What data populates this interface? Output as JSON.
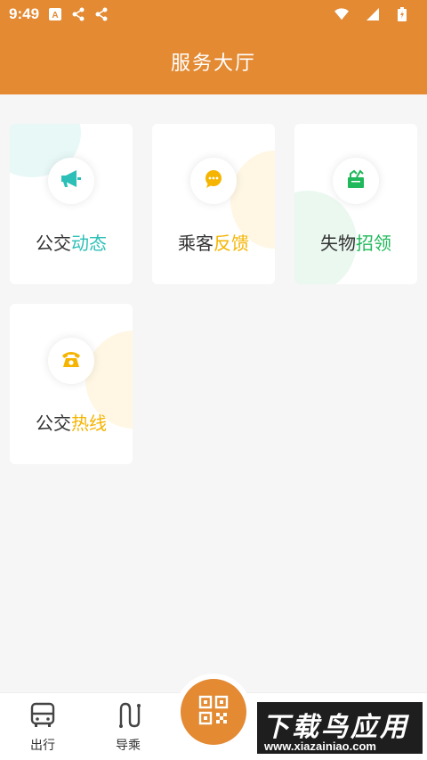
{
  "status_bar": {
    "time": "9:49",
    "left_icons": [
      "a-icon",
      "share-icon",
      "share-icon"
    ],
    "right_icons": [
      "wifi-icon",
      "signal-icon",
      "battery-icon"
    ]
  },
  "header": {
    "title": "服务大厅"
  },
  "cards": [
    {
      "label_prefix": "公交",
      "label_highlight": "动态",
      "accent": "#2bbfb7",
      "icon": "megaphone-icon"
    },
    {
      "label_prefix": "乘客",
      "label_highlight": "反馈",
      "accent": "#f5b400",
      "icon": "chat-bubble-icon"
    },
    {
      "label_prefix": "失物",
      "label_highlight": "招领",
      "accent": "#1fb85a",
      "icon": "lost-found-bag-icon"
    },
    {
      "label_prefix": "公交",
      "label_highlight": "热线",
      "accent": "#f5b400",
      "icon": "telephone-icon"
    }
  ],
  "tabbar": {
    "tabs": [
      {
        "label": "出行",
        "icon": "bus-icon"
      },
      {
        "label": "导乘",
        "icon": "route-icon"
      }
    ],
    "center_icon": "qr-code-icon"
  },
  "watermark": {
    "title": "下载鸟应用",
    "url": "www.xiazainiao.com"
  },
  "colors": {
    "brand": "#e38a33",
    "background": "#f6f6f6"
  }
}
